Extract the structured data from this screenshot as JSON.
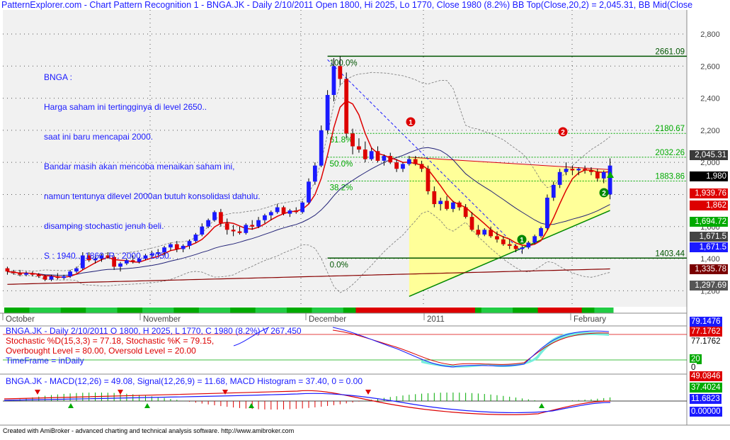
{
  "title": "PatternExplorer.com - Chart Pattern Recognition 1  - BNGA.JK - Daily 2/10/2011 Open 1800, Hi 2025, Lo 1770, Close 1980 (8.2%) BB Top(Close,20,2) = 2,045.31, BB Mid(Close",
  "note": {
    "lines": [
      "BNGA :",
      "Harga saham ini tertingginya di level 2650..",
      "saat ini baru mencapai 2000.",
      "Bandar masih akan mencoba menaikan saham ini,",
      "namun tentunya dilevel 2000an butuh konsolidasi dahulu.",
      "disamping stochastic jenuh beli.",
      "S : 1940... 1860, R : 2000... 2050."
    ]
  },
  "chart_data": {
    "type": "candlestick",
    "symbol": "BNGA.JK",
    "ylim": [
      1100,
      2950
    ],
    "y_ticks": [
      "1,200",
      "1,400",
      "1,600",
      "1,800",
      "2,000",
      "2,200",
      "2,400",
      "2,600",
      "2,800"
    ],
    "x_labels": [
      "October",
      "November",
      "December",
      "2011",
      "February"
    ],
    "candles": [
      [
        1340,
        1350,
        1300,
        1320
      ],
      [
        1320,
        1330,
        1300,
        1310
      ],
      [
        1310,
        1330,
        1290,
        1300
      ],
      [
        1300,
        1320,
        1290,
        1310
      ],
      [
        1310,
        1320,
        1290,
        1300
      ],
      [
        1300,
        1310,
        1280,
        1290
      ],
      [
        1290,
        1300,
        1260,
        1270
      ],
      [
        1270,
        1300,
        1260,
        1290
      ],
      [
        1290,
        1310,
        1270,
        1280
      ],
      [
        1280,
        1300,
        1270,
        1290
      ],
      [
        1290,
        1330,
        1280,
        1320
      ],
      [
        1320,
        1350,
        1310,
        1340
      ],
      [
        1340,
        1440,
        1330,
        1420
      ],
      [
        1420,
        1440,
        1380,
        1390
      ],
      [
        1390,
        1410,
        1370,
        1400
      ],
      [
        1400,
        1430,
        1380,
        1420
      ],
      [
        1420,
        1440,
        1400,
        1410
      ],
      [
        1410,
        1420,
        1330,
        1350
      ],
      [
        1350,
        1380,
        1320,
        1370
      ],
      [
        1370,
        1400,
        1360,
        1390
      ],
      [
        1390,
        1420,
        1370,
        1380
      ],
      [
        1380,
        1410,
        1370,
        1400
      ],
      [
        1400,
        1430,
        1390,
        1420
      ],
      [
        1420,
        1450,
        1410,
        1430
      ],
      [
        1430,
        1460,
        1420,
        1440
      ],
      [
        1440,
        1480,
        1420,
        1470
      ],
      [
        1470,
        1500,
        1450,
        1490
      ],
      [
        1490,
        1510,
        1440,
        1460
      ],
      [
        1460,
        1490,
        1440,
        1480
      ],
      [
        1480,
        1520,
        1460,
        1510
      ],
      [
        1510,
        1560,
        1500,
        1550
      ],
      [
        1550,
        1620,
        1540,
        1600
      ],
      [
        1600,
        1650,
        1590,
        1640
      ],
      [
        1640,
        1700,
        1630,
        1690
      ],
      [
        1690,
        1710,
        1600,
        1620
      ],
      [
        1620,
        1650,
        1550,
        1580
      ],
      [
        1580,
        1610,
        1540,
        1570
      ],
      [
        1570,
        1600,
        1550,
        1560
      ],
      [
        1560,
        1620,
        1550,
        1610
      ],
      [
        1610,
        1640,
        1580,
        1600
      ],
      [
        1600,
        1660,
        1590,
        1640
      ],
      [
        1640,
        1680,
        1620,
        1670
      ],
      [
        1670,
        1700,
        1640,
        1690
      ],
      [
        1690,
        1740,
        1680,
        1720
      ],
      [
        1720,
        1730,
        1670,
        1680
      ],
      [
        1680,
        1710,
        1660,
        1700
      ],
      [
        1700,
        1720,
        1680,
        1690
      ],
      [
        1690,
        1760,
        1680,
        1750
      ],
      [
        1750,
        1900,
        1740,
        1880
      ],
      [
        1880,
        2000,
        1860,
        1980
      ],
      [
        1980,
        2230,
        1970,
        2200
      ],
      [
        2200,
        2450,
        2180,
        2420
      ],
      [
        2420,
        2650,
        2380,
        2600
      ],
      [
        2600,
        2661,
        2480,
        2520
      ],
      [
        2520,
        2560,
        2150,
        2180
      ],
      [
        2180,
        2210,
        2050,
        2100
      ],
      [
        2100,
        2150,
        2060,
        2080
      ],
      [
        2080,
        2130,
        2000,
        2020
      ],
      [
        2020,
        2090,
        2010,
        2070
      ],
      [
        2070,
        2100,
        2000,
        2010
      ],
      [
        2010,
        2050,
        1980,
        2040
      ],
      [
        2040,
        2060,
        1990,
        2000
      ],
      [
        2000,
        2020,
        1940,
        1960
      ],
      [
        1960,
        2000,
        1940,
        1990
      ],
      [
        1990,
        2040,
        1980,
        2020
      ],
      [
        2020,
        2040,
        1980,
        1990
      ],
      [
        1990,
        2010,
        1940,
        1960
      ],
      [
        1960,
        1980,
        1800,
        1820
      ],
      [
        1820,
        1850,
        1720,
        1740
      ],
      [
        1740,
        1780,
        1700,
        1760
      ],
      [
        1760,
        1790,
        1700,
        1710
      ],
      [
        1710,
        1760,
        1690,
        1750
      ],
      [
        1750,
        1760,
        1700,
        1720
      ],
      [
        1720,
        1740,
        1650,
        1660
      ],
      [
        1660,
        1690,
        1570,
        1580
      ],
      [
        1580,
        1610,
        1540,
        1550
      ],
      [
        1550,
        1590,
        1540,
        1580
      ],
      [
        1580,
        1600,
        1530,
        1540
      ],
      [
        1540,
        1570,
        1500,
        1520
      ],
      [
        1520,
        1540,
        1480,
        1490
      ],
      [
        1490,
        1520,
        1460,
        1480
      ],
      [
        1480,
        1490,
        1440,
        1460
      ],
      [
        1460,
        1480,
        1430,
        1470
      ],
      [
        1470,
        1510,
        1460,
        1500
      ],
      [
        1500,
        1550,
        1490,
        1540
      ],
      [
        1540,
        1600,
        1530,
        1590
      ],
      [
        1590,
        1800,
        1580,
        1780
      ],
      [
        1780,
        1880,
        1760,
        1860
      ],
      [
        1860,
        1960,
        1840,
        1940
      ],
      [
        1940,
        2000,
        1920,
        1960
      ],
      [
        1960,
        1980,
        1920,
        1950
      ],
      [
        1950,
        1970,
        1920,
        1960
      ],
      [
        1960,
        1980,
        1930,
        1950
      ],
      [
        1950,
        1970,
        1920,
        1940
      ],
      [
        1940,
        1960,
        1880,
        1900
      ],
      [
        1900,
        1950,
        1870,
        1940
      ],
      [
        1800,
        2025,
        1770,
        1980
      ]
    ],
    "fib_levels": [
      {
        "label": "100.0%",
        "value": 2661.09
      },
      {
        "label": "61.8%",
        "value": 2180.67
      },
      {
        "label": "50.0%",
        "value": 2032.26
      },
      {
        "label": "38.2%",
        "value": 1883.86
      },
      {
        "label": "0.0%",
        "value": 1403.44
      }
    ],
    "right_tags": [
      {
        "text": "2,045.31",
        "value": 2045.31,
        "bg": "#3a3a3a",
        "fg": "#ffffff"
      },
      {
        "text": "1,980",
        "value": 1980,
        "bg": "#000000",
        "fg": "#ffffff"
      },
      {
        "text": "1,939.76",
        "value": 1939.76,
        "bg": "#dd0000",
        "fg": "#ffffff"
      },
      {
        "text": "1,862",
        "value": 1862,
        "bg": "#dd0000",
        "fg": "#ffffff"
      },
      {
        "text": "1,694.72",
        "value": 1694.72,
        "bg": "#00aa00",
        "fg": "#ffffff"
      },
      {
        "text": "1,671.5",
        "value": 1671.5,
        "bg": "#444444",
        "fg": "#ffffff"
      },
      {
        "text": "1,671.5",
        "value": 1671.5,
        "bg": "#1a1aff",
        "fg": "#ffffff"
      },
      {
        "text": "1,335.78",
        "value": 1335.78,
        "bg": "#7a0000",
        "fg": "#ffffff"
      },
      {
        "text": "1,297.69",
        "value": 1297.69,
        "bg": "#555555",
        "fg": "#ffffff"
      }
    ],
    "markers": [
      {
        "text": "1",
        "color": "#dd0000"
      },
      {
        "text": "2",
        "color": "#dd0000"
      },
      {
        "text": "1",
        "color": "#008800"
      },
      {
        "text": "2",
        "color": "#008800"
      }
    ],
    "colors": {
      "up": "#1a1aff",
      "down": "#dd0000",
      "triangle": "#ffff99",
      "ma_red": "#dd0000",
      "ma_blue": "#222277",
      "ma_long": "#880000"
    }
  },
  "stochastic": {
    "line1": "BNGA.JK - Daily 2/10/2011 O 1800, H 2025, L 1770, C 1980 (8.2%) V 267,450",
    "line2": "Stochastic %D(15,3,3) = 77.18, Stochastic %K = 79.15,",
    "line3": "Overbought Level = 80.00, Oversold Level = 20.00",
    "line4": "TimeFrame = inDaily",
    "tags": [
      {
        "text": "79.1476",
        "bg": "#1a1aff",
        "fg": "#ffffff"
      },
      {
        "text": "77.1762",
        "bg": "#dd0000",
        "fg": "#ffffff"
      },
      {
        "text": "77.1762",
        "bg": "#ffffff",
        "fg": "#000000"
      },
      {
        "text": "20",
        "bg": "#00aa00",
        "fg": "#ffffff"
      },
      {
        "text": "0",
        "bg": "#ffffff",
        "fg": "#000000"
      }
    ]
  },
  "macd": {
    "label": "BNGA.JK - MACD(12,26) = 49.08, Signal(12,26,9) = 11.68, MACD Histogram = 37.40, 0 = 0.00",
    "tags": [
      {
        "text": "49.0846",
        "bg": "#dd0000",
        "fg": "#ffffff"
      },
      {
        "text": "37.4024",
        "bg": "#00aa00",
        "fg": "#ffffff"
      },
      {
        "text": "11.6823",
        "bg": "#1a1aff",
        "fg": "#ffffff"
      },
      {
        "text": "0.00000",
        "bg": "#1a1aff",
        "fg": "#ffffff"
      }
    ]
  },
  "footer": "Created with AmiBroker - advanced charting and technical analysis software. http://www.amibroker.com"
}
